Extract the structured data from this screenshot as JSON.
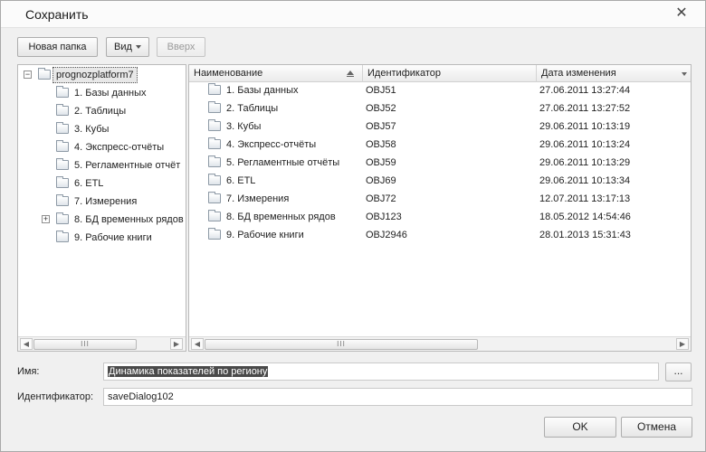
{
  "window": {
    "title": "Сохранить",
    "close_icon": "close-icon"
  },
  "toolbar": {
    "new_folder": "Новая папка",
    "view": "Вид",
    "up": "Вверх"
  },
  "tree": {
    "root": "prognozplatform7",
    "items": [
      {
        "label": "1. Базы данных",
        "expandable": false
      },
      {
        "label": "2. Таблицы",
        "expandable": false
      },
      {
        "label": "3. Кубы",
        "expandable": false
      },
      {
        "label": "4. Экспресс-отчёты",
        "expandable": false
      },
      {
        "label": "5. Регламентные отчёт",
        "expandable": false
      },
      {
        "label": "6. ETL",
        "expandable": false
      },
      {
        "label": "7. Измерения",
        "expandable": false
      },
      {
        "label": "8. БД временных рядов",
        "expandable": true
      },
      {
        "label": "9. Рабочие книги",
        "expandable": false
      }
    ]
  },
  "table": {
    "columns": [
      "Наименование",
      "Идентификатор",
      "Дата изменения"
    ],
    "rows": [
      {
        "name": "1. Базы данных",
        "id": "OBJ51",
        "date": "27.06.2011 13:27:44"
      },
      {
        "name": "2. Таблицы",
        "id": "OBJ52",
        "date": "27.06.2011 13:27:52"
      },
      {
        "name": "3. Кубы",
        "id": "OBJ57",
        "date": "29.06.2011 10:13:19"
      },
      {
        "name": "4. Экспресс-отчёты",
        "id": "OBJ58",
        "date": "29.06.2011 10:13:24"
      },
      {
        "name": "5. Регламентные отчёты",
        "id": "OBJ59",
        "date": "29.06.2011 10:13:29"
      },
      {
        "name": "6. ETL",
        "id": "OBJ69",
        "date": "29.06.2011 10:13:34"
      },
      {
        "name": "7. Измерения",
        "id": "OBJ72",
        "date": "12.07.2011 13:17:13"
      },
      {
        "name": "8. БД временных рядов",
        "id": "OBJ123",
        "date": "18.05.2012 14:54:46"
      },
      {
        "name": "9. Рабочие книги",
        "id": "OBJ2946",
        "date": "28.01.2013 15:31:43"
      }
    ]
  },
  "form": {
    "name_label": "Имя:",
    "name_value": "Динамика показателей по региону",
    "browse_label": "...",
    "id_label": "Идентификатор:",
    "id_value": "saveDialog102"
  },
  "buttons": {
    "ok": "OK",
    "cancel": "Отмена"
  },
  "scrollbar_thumb": "III"
}
